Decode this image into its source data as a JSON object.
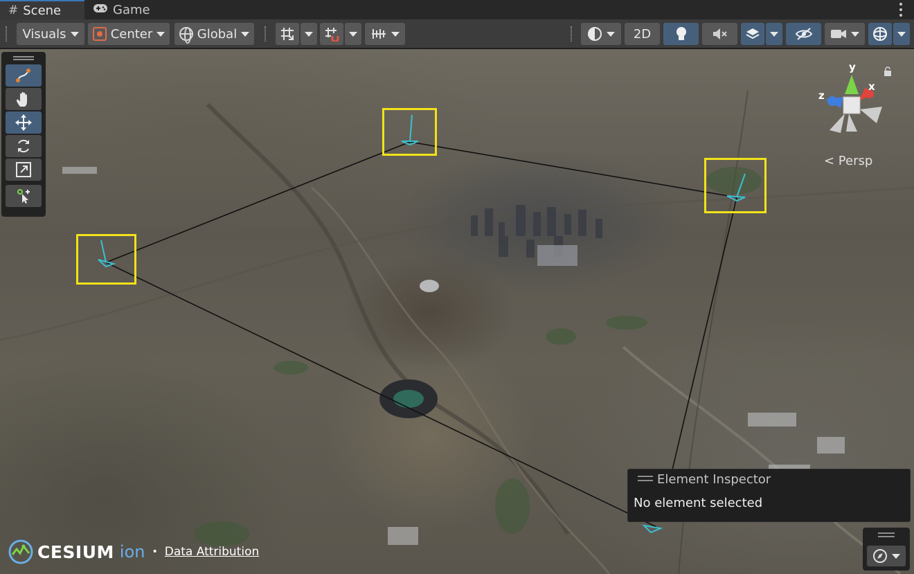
{
  "tabs": [
    {
      "label": "Scene",
      "icon": "grid-hash-icon",
      "active": true
    },
    {
      "label": "Game",
      "icon": "gamepad-icon",
      "active": false
    }
  ],
  "toolbar": {
    "visuals_label": "Visuals",
    "pivot_label": "Center",
    "space_label": "Global",
    "mode_2d_label": "2D",
    "active_toggles": [
      "lighting",
      "layers",
      "visibility",
      "gizmos"
    ]
  },
  "tools": [
    {
      "name": "path-tool",
      "active": true
    },
    {
      "name": "hand-tool",
      "active": false
    },
    {
      "name": "move-tool",
      "active": true
    },
    {
      "name": "rotate-tool",
      "active": false
    },
    {
      "name": "scale-tool",
      "active": false
    },
    {
      "name": "custom-tool",
      "active": false
    }
  ],
  "gizmo": {
    "axis_y": "y",
    "axis_x": "x",
    "axis_z": "z",
    "projection_label": "< Persp"
  },
  "inspector": {
    "title": "Element Inspector",
    "message": "No element selected"
  },
  "attribution": {
    "brand": "CESIUM",
    "brand_suffix": "ion",
    "separator": "•",
    "link": "Data Attribution"
  },
  "colors": {
    "highlight": "#f2e21a",
    "active_button": "#46607c",
    "accent_tab": "#3a79bb",
    "cesium_ion": "#6aaee8",
    "axis_x": "#e0443a",
    "axis_y": "#7bd34a",
    "axis_z": "#3f7ee0"
  }
}
